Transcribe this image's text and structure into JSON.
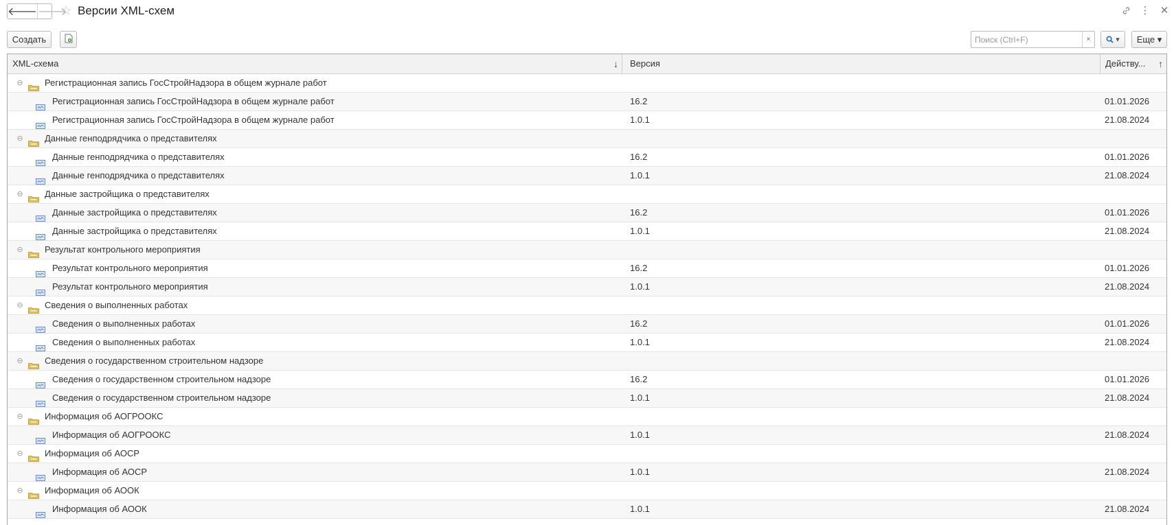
{
  "window": {
    "title": "Версии XML-схем",
    "nav_back": "🡐",
    "nav_forward": "🡒",
    "star": "☆",
    "icon_link": "🔗",
    "icon_more": "⋮",
    "icon_close": "✕"
  },
  "toolbar": {
    "create_label": "Создать",
    "search_placeholder": "Поиск (Ctrl+F)",
    "search_clear": "×",
    "search_button": "🔍 ▾",
    "more_label": "Еще ▾"
  },
  "table": {
    "columns": [
      {
        "label": "XML-схема",
        "sort": "↓"
      },
      {
        "label": "Версия"
      },
      {
        "label": "Действу...",
        "sort": "↑"
      }
    ],
    "rows": [
      {
        "type": "group",
        "name": "Регистрационная запись ГосСтройНадзора в общем журнале работ",
        "version": "",
        "date": ""
      },
      {
        "type": "item",
        "name": "Регистрационная запись ГосСтройНадзора в общем журнале работ",
        "version": "16.2",
        "date": "01.01.2026"
      },
      {
        "type": "item",
        "name": "Регистрационная запись ГосСтройНадзора в общем журнале работ",
        "version": "1.0.1",
        "date": "21.08.2024"
      },
      {
        "type": "group",
        "name": "Данные генподрядчика о представителях",
        "version": "",
        "date": ""
      },
      {
        "type": "item",
        "name": "Данные генподрядчика о представителях",
        "version": "16.2",
        "date": "01.01.2026"
      },
      {
        "type": "item",
        "name": "Данные генподрядчика о представителях",
        "version": "1.0.1",
        "date": "21.08.2024"
      },
      {
        "type": "group",
        "name": "Данные застройщика о представителях",
        "version": "",
        "date": ""
      },
      {
        "type": "item",
        "name": "Данные застройщика о представителях",
        "version": "16.2",
        "date": "01.01.2026"
      },
      {
        "type": "item",
        "name": "Данные застройщика о представителях",
        "version": "1.0.1",
        "date": "21.08.2024"
      },
      {
        "type": "group",
        "name": "Результат контрольного мероприятия",
        "version": "",
        "date": ""
      },
      {
        "type": "item",
        "name": "Результат контрольного мероприятия",
        "version": "16.2",
        "date": "01.01.2026"
      },
      {
        "type": "item",
        "name": "Результат контрольного мероприятия",
        "version": "1.0.1",
        "date": "21.08.2024"
      },
      {
        "type": "group",
        "name": "Сведения о выполненных работах",
        "version": "",
        "date": ""
      },
      {
        "type": "item",
        "name": "Сведения о выполненных работах",
        "version": "16.2",
        "date": "01.01.2026"
      },
      {
        "type": "item",
        "name": "Сведения о выполненных работах",
        "version": "1.0.1",
        "date": "21.08.2024"
      },
      {
        "type": "group",
        "name": "Сведения о государственном строительном надзоре",
        "version": "",
        "date": ""
      },
      {
        "type": "item",
        "name": "Сведения о государственном строительном надзоре",
        "version": "16.2",
        "date": "01.01.2026"
      },
      {
        "type": "item",
        "name": "Сведения о государственном строительном надзоре",
        "version": "1.0.1",
        "date": "21.08.2024"
      },
      {
        "type": "group",
        "name": "Информация об АОГРООКС",
        "version": "",
        "date": ""
      },
      {
        "type": "item",
        "name": "Информация об АОГРООКС",
        "version": "1.0.1",
        "date": "21.08.2024"
      },
      {
        "type": "group",
        "name": "Информация об АОСР",
        "version": "",
        "date": ""
      },
      {
        "type": "item",
        "name": "Информация об АОСР",
        "version": "1.0.1",
        "date": "21.08.2024"
      },
      {
        "type": "group",
        "name": "Информация об АООК",
        "version": "",
        "date": ""
      },
      {
        "type": "item",
        "name": "Информация об АООК",
        "version": "1.0.1",
        "date": "21.08.2024"
      }
    ]
  },
  "colors": {
    "folder": "#d9b44a",
    "item_icon": "#5a82b8",
    "save_icon": "#3e9b3e"
  }
}
